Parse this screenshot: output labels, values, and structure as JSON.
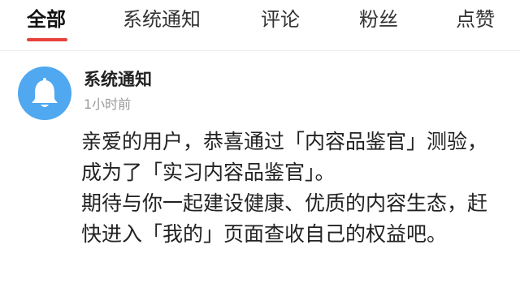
{
  "tabs": [
    {
      "label": "全部",
      "active": true
    },
    {
      "label": "系统通知",
      "active": false
    },
    {
      "label": "评论",
      "active": false
    },
    {
      "label": "粉丝",
      "active": false
    },
    {
      "label": "点赞",
      "active": false
    }
  ],
  "notification": {
    "avatar_icon": "bell-icon",
    "sender": "系统通知",
    "time": "1小时前",
    "paragraphs": [
      "亲爱的用户，恭喜通过「内容品鉴官」测验，成为了「实习内容品鉴官」。",
      "期待与你一起建设健康、优质的内容生态，赶快进入「我的」页面查收自己的权益吧。"
    ]
  },
  "colors": {
    "accent": "#e8413b",
    "avatar_bg": "#4fa8f0",
    "muted_text": "#9a9a9a"
  }
}
